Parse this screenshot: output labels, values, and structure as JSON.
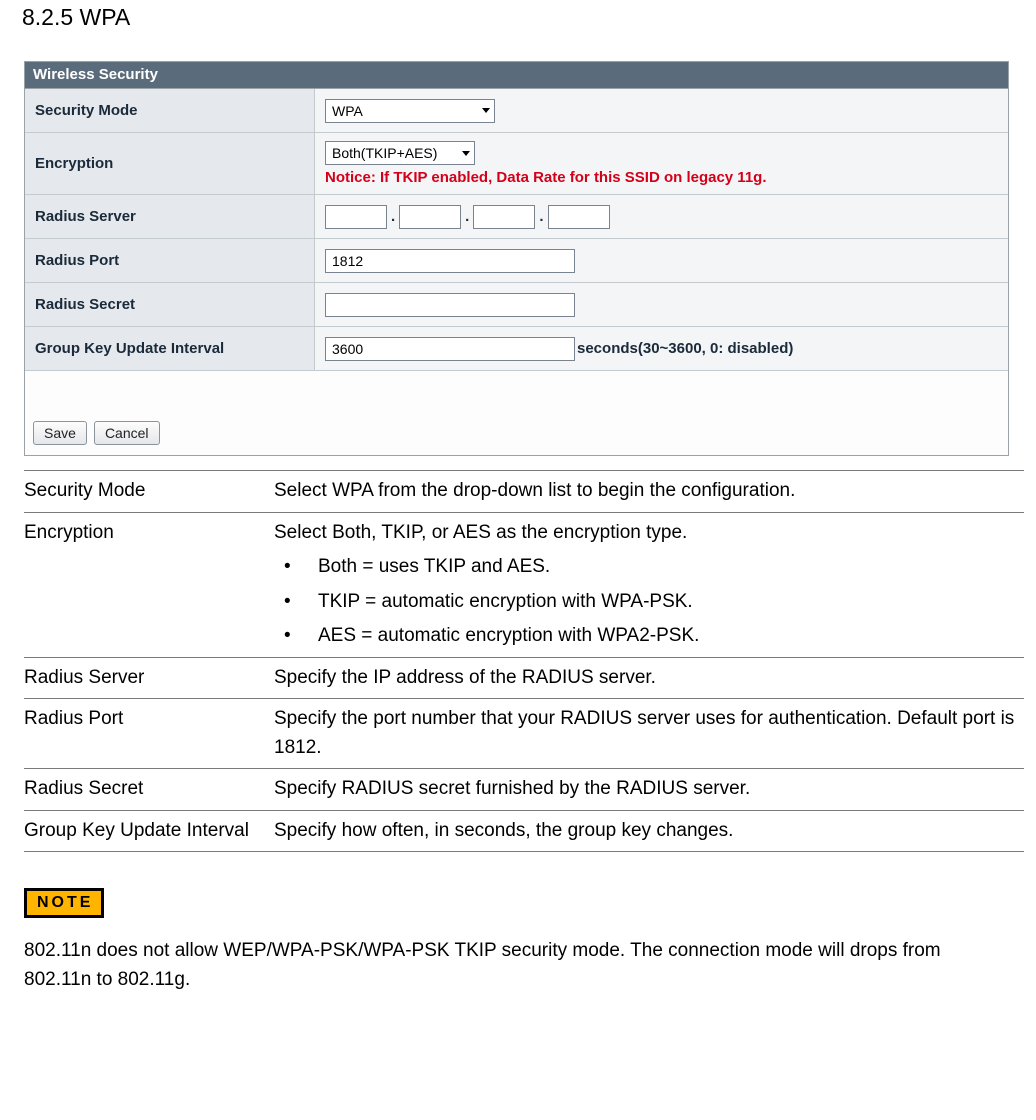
{
  "section_title": "8.2.5 WPA",
  "panel": {
    "header": "Wireless Security",
    "security_mode": {
      "label": "Security Mode",
      "value": "WPA"
    },
    "encryption": {
      "label": "Encryption",
      "value": "Both(TKIP+AES)",
      "notice": "Notice: If TKIP enabled, Data Rate for this SSID on legacy 11g."
    },
    "radius_server": {
      "label": "Radius Server",
      "octets": [
        "",
        "",
        "",
        ""
      ]
    },
    "radius_port": {
      "label": "Radius Port",
      "value": "1812"
    },
    "radius_secret": {
      "label": "Radius Secret",
      "value": ""
    },
    "group_key": {
      "label": "Group Key Update Interval",
      "value": "3600",
      "suffix": "seconds(30~3600, 0: disabled)"
    },
    "buttons": {
      "save": "Save",
      "cancel": "Cancel"
    }
  },
  "descriptions": {
    "security_mode": {
      "term": "Security Mode",
      "text": "Select WPA from the drop-down  list to begin the configuration."
    },
    "encryption": {
      "term": "Encryption",
      "text": "Select Both, TKIP, or AES as the encryption type.",
      "items": [
        "Both = uses TKIP and AES.",
        "TKIP = automatic encryption with WPA-PSK.",
        "AES = automatic encryption with WPA2-PSK."
      ]
    },
    "radius_server": {
      "term": "Radius Server",
      "text": "Specify the IP address of the RADIUS server."
    },
    "radius_port": {
      "term": "Radius Port",
      "text": "Specify the port number that your RADIUS server uses for authentication. Default port is 1812."
    },
    "radius_secret": {
      "term": "Radius Secret",
      "text": "Specify RADIUS secret furnished by the RADIUS server."
    },
    "group_key": {
      "term": "Group Key Update Interval",
      "text": "Specify how often, in seconds, the group key changes."
    }
  },
  "note": {
    "label": "NOTE",
    "text": "802.11n does not allow WEP/WPA-PSK/WPA-PSK TKIP security mode. The connection mode will drops from 802.11n to 802.11g."
  }
}
